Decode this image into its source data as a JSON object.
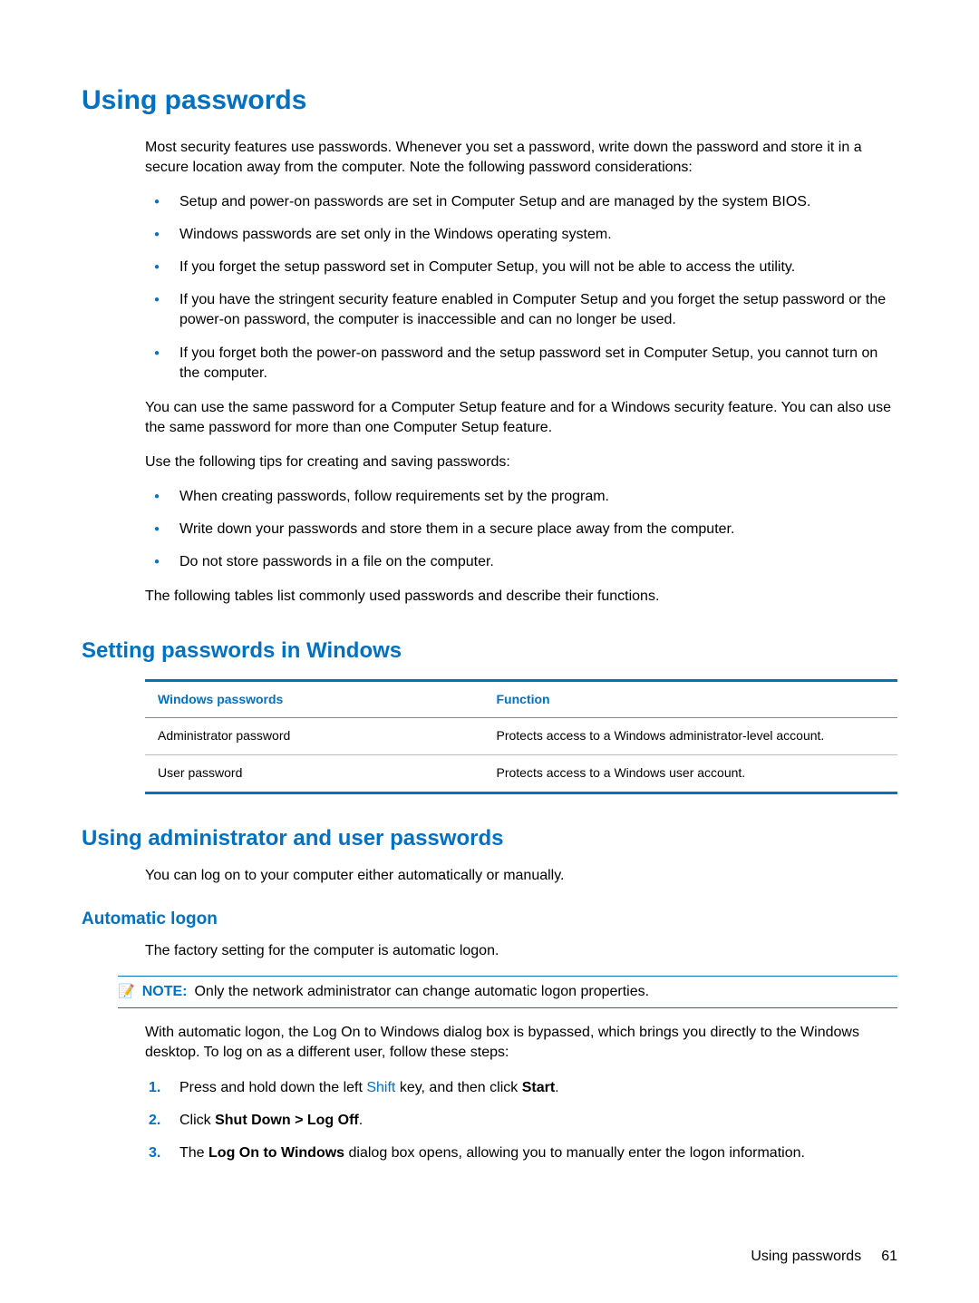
{
  "heading": "Using passwords",
  "intro": "Most security features use passwords. Whenever you set a password, write down the password and store it in a secure location away from the computer. Note the following password considerations:",
  "considerations": [
    "Setup and power-on passwords are set in Computer Setup and are managed by the system BIOS.",
    "Windows passwords are set only in the Windows operating system.",
    "If you forget the setup password set in Computer Setup, you will not be able to access the utility.",
    "If you have the stringent security feature enabled in Computer Setup and you forget the setup password or the power-on password, the computer is inaccessible and can no longer be used.",
    "If you forget both the power-on password and the setup password set in Computer Setup, you cannot turn on the computer."
  ],
  "reuse_para": "You can use the same password for a Computer Setup feature and for a Windows security feature. You can also use the same password for more than one Computer Setup feature.",
  "tips_intro": "Use the following tips for creating and saving passwords:",
  "tips": [
    "When creating passwords, follow requirements set by the program.",
    "Write down your passwords and store them in a secure place away from the computer.",
    "Do not store passwords in a file on the computer."
  ],
  "tables_intro": "The following tables list commonly used passwords and describe their functions.",
  "section_windows": {
    "title": "Setting passwords in Windows",
    "table": {
      "headers": [
        "Windows passwords",
        "Function"
      ],
      "rows": [
        [
          "Administrator password",
          "Protects access to a Windows administrator-level account."
        ],
        [
          "User password",
          "Protects access to a Windows user account."
        ]
      ]
    }
  },
  "section_admin_user": {
    "title": "Using administrator and user passwords",
    "intro": "You can log on to your computer either automatically or manually.",
    "auto_logon": {
      "title": "Automatic logon",
      "factory": "The factory setting for the computer is automatic logon.",
      "note_label": "NOTE:",
      "note_text": "Only the network administrator can change automatic logon properties.",
      "bypass": "With automatic logon, the Log On to Windows dialog box is bypassed, which brings you directly to the Windows desktop. To log on as a different user, follow these steps:",
      "steps": {
        "s1_pre": "Press and hold down the left ",
        "s1_shift": "Shift",
        "s1_mid": " key, and then click ",
        "s1_start": "Start",
        "s1_post": ".",
        "s2_pre": "Click ",
        "s2_bold": "Shut Down > Log Off",
        "s2_post": ".",
        "s3_pre": "The ",
        "s3_bold": "Log On to Windows",
        "s3_post": " dialog box opens, allowing you to manually enter the logon information."
      }
    }
  },
  "footer": {
    "label": "Using passwords",
    "page": "61"
  }
}
